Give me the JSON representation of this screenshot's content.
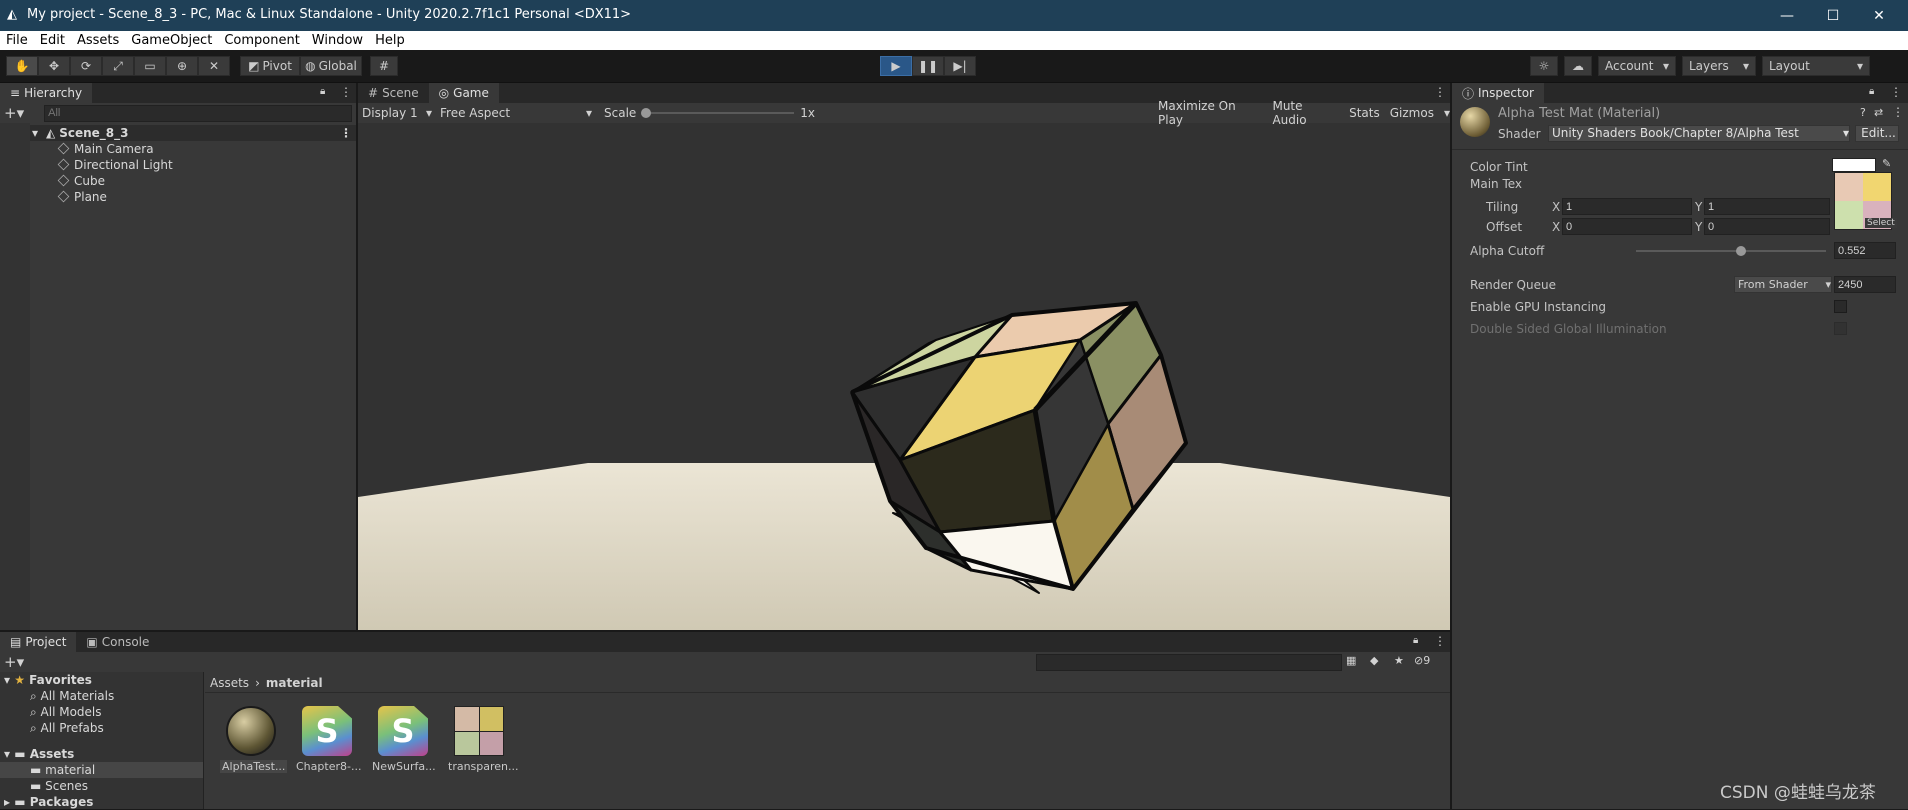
{
  "window": {
    "title": "My project - Scene_8_3 - PC, Mac & Linux Standalone - Unity 2020.2.7f1c1 Personal <DX11>"
  },
  "menu": [
    "File",
    "Edit",
    "Assets",
    "GameObject",
    "Component",
    "Window",
    "Help"
  ],
  "toolbar": {
    "pivot": "Pivot",
    "global": "Global",
    "account": "Account",
    "layers": "Layers",
    "layout": "Layout"
  },
  "hierarchy": {
    "tab": "Hierarchy",
    "search_placeholder": "All",
    "scene": "Scene_8_3",
    "items": [
      "Main Camera",
      "Directional Light",
      "Cube",
      "Plane"
    ]
  },
  "view": {
    "tabs": [
      "Scene",
      "Game"
    ],
    "display": "Display 1",
    "aspect": "Free Aspect",
    "scale_label": "Scale",
    "scale_value": "1x",
    "maximize": "Maximize On Play",
    "mute": "Mute Audio",
    "stats": "Stats",
    "gizmos": "Gizmos"
  },
  "inspector": {
    "tab": "Inspector",
    "title": "Alpha Test Mat (Material)",
    "shader_label": "Shader",
    "shader_value": "Unity Shaders Book/Chapter 8/Alpha Test",
    "edit": "Edit...",
    "color_tint": "Color Tint",
    "main_tex": "Main Tex",
    "tiling": "Tiling",
    "offset": "Offset",
    "x": "X",
    "y": "Y",
    "tiling_x": "1",
    "tiling_y": "1",
    "offset_x": "0",
    "offset_y": "0",
    "select": "Select",
    "alpha_cutoff": "Alpha Cutoff",
    "alpha_cutoff_value": "0.552",
    "alpha_cutoff_fraction": 0.552,
    "render_queue": "Render Queue",
    "render_queue_mode": "From Shader",
    "render_queue_value": "2450",
    "gpu_instancing": "Enable GPU Instancing",
    "double_sided": "Double Sided Global Illumination"
  },
  "project": {
    "tabs": [
      "Project",
      "Console"
    ],
    "favorites": "Favorites",
    "fav_items": [
      "All Materials",
      "All Models",
      "All Prefabs"
    ],
    "assets": "Assets",
    "asset_folders": [
      "material",
      "Scenes"
    ],
    "packages": "Packages",
    "breadcrumb_root": "Assets",
    "breadcrumb_current": "material",
    "hidden_count": "9",
    "files": [
      "AlphaTest...",
      "Chapter8-...",
      "NewSurfa...",
      "transparen..."
    ]
  },
  "watermark": "CSDN @蛙蛙乌龙茶",
  "colors": {
    "accent": "#2a5788",
    "scene_bg": "#323232",
    "plane": "#d9d2bf"
  }
}
